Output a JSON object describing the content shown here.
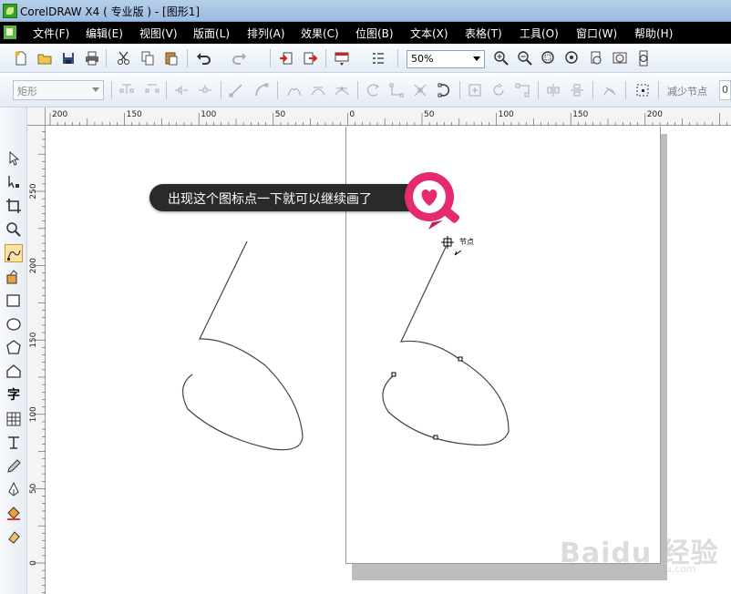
{
  "window": {
    "title": "CorelDRAW X4 ( 专业版 ) - [图形1]"
  },
  "menu": {
    "items": [
      "文件(F)",
      "编辑(E)",
      "视图(V)",
      "版面(L)",
      "排列(A)",
      "效果(C)",
      "位图(B)",
      "文本(X)",
      "表格(T)",
      "工具(O)",
      "窗口(W)",
      "帮助(H)"
    ]
  },
  "toolbar": {
    "zoom_value": "50%"
  },
  "property_bar": {
    "shape_select": "矩形",
    "reduce_nodes_label": "减少节点",
    "reduce_nodes_value": "0"
  },
  "ruler": {
    "h_labels": [
      "200",
      "150",
      "100",
      "50",
      "0",
      "50",
      "100",
      "150",
      "200"
    ],
    "v_labels": [
      "250",
      "200",
      "150",
      "100",
      "50",
      "0"
    ]
  },
  "canvas": {
    "callout_text": "出现这个图标点一下就可以继续画了",
    "node_tooltip": "节点"
  },
  "toolbox": {
    "text_tool_glyph": "字"
  },
  "watermark": {
    "main": "Baidu 经验",
    "sub": "jingyan.baidu.com"
  },
  "colors": {
    "menubar": "#000000",
    "callout_bg": "#2a2a2a",
    "badge_pink": "#e52a6f"
  }
}
